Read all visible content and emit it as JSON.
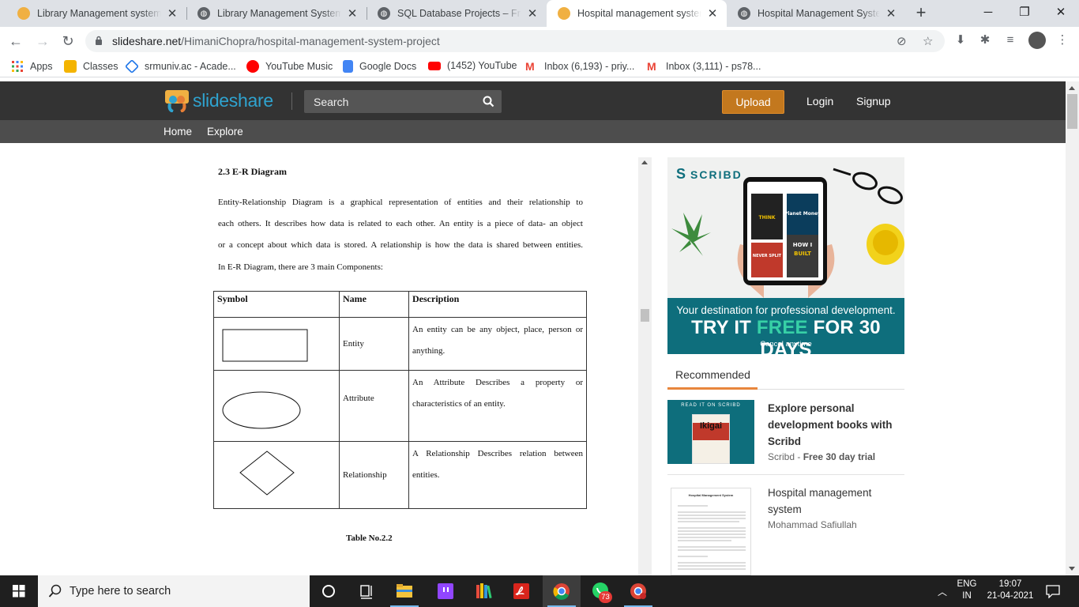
{
  "browser": {
    "tabs": [
      {
        "title": "Library Management system D",
        "favicon": "slideshare-icon",
        "active": false
      },
      {
        "title": "Library Management System D",
        "favicon": "globe-icon",
        "active": false
      },
      {
        "title": "SQL Database Projects – Free D",
        "favicon": "globe-icon",
        "active": false
      },
      {
        "title": "Hospital management system |",
        "favicon": "slideshare-icon",
        "active": true
      },
      {
        "title": "Hospital Management System",
        "favicon": "globe-icon",
        "active": false
      }
    ],
    "new_tab": "+",
    "url_host": "slideshare.net",
    "url_path": "/HimaniChopra/hospital-management-system-project",
    "bookmarks": [
      {
        "label": "Apps",
        "icon": "apps-grid-icon",
        "color": "#ea4335"
      },
      {
        "label": "Classes",
        "icon": "classroom-icon",
        "color": "#f4b400"
      },
      {
        "label": "srmuniv.ac - Acade...",
        "icon": "srm-icon",
        "color": "#1a73e8"
      },
      {
        "label": "YouTube Music",
        "icon": "youtube-music-icon",
        "color": "#ff0000"
      },
      {
        "label": "Google Docs",
        "icon": "google-docs-icon",
        "color": "#4285f4"
      },
      {
        "label": "(1452) YouTube",
        "icon": "youtube-icon",
        "color": "#ff0000"
      },
      {
        "label": "Inbox (6,193) - priy...",
        "icon": "gmail-icon",
        "color": "#ea4335"
      },
      {
        "label": "Inbox (3,111) - ps78...",
        "icon": "gmail-icon",
        "color": "#ea4335"
      }
    ]
  },
  "slideshare": {
    "logo_text": "slideshare",
    "search_placeholder": "Search",
    "upload_label": "Upload",
    "login_label": "Login",
    "signup_label": "Signup",
    "subnav": [
      "Home",
      "Explore"
    ],
    "brand_color": "#2fa3cf",
    "accent_color": "#c3781e"
  },
  "document": {
    "heading": "2.3 E-R Diagram",
    "paragraph_lines": [
      "Entity-Relationship Diagram is a graphical representation of entities and their relationship to",
      "each others. It describes how data is related to each other. An entity is a piece of data- an object",
      "or a concept about which data is stored. A relationship is how the data is shared between entities.",
      "In E-R Diagram, there are 3 main Components:"
    ],
    "table": {
      "headers": [
        "Symbol",
        "Name",
        "Description"
      ],
      "rows": [
        {
          "symbol": "rectangle",
          "name": "Entity",
          "desc_lines": [
            "An entity can be any object, place, person or",
            "anything."
          ]
        },
        {
          "symbol": "ellipse",
          "name": "Attribute",
          "desc_lines": [
            "An Attribute Describes a property or",
            "characteristics of an entity."
          ]
        },
        {
          "symbol": "diamond",
          "name": "Relationship",
          "desc_lines": [
            "A Relationship Describes relation between",
            "entities."
          ]
        }
      ]
    },
    "caption": "Table No.2.2"
  },
  "ad": {
    "brand": "SCRIBD",
    "line1": "Your destination for professional development.",
    "line2_a": "TRY IT ",
    "line2_free": "FREE",
    "line2_b": " FOR 30 DAYS",
    "line3": "Cancel anytime",
    "books": [
      "THINK LIKE A BILLIONAIRE",
      "Planet Money",
      "NEVER SPLIT THE DIFFERENCE",
      "HOW I BUILT THIS"
    ],
    "bg_color": "#0e6e7c",
    "free_color": "#37d0a6"
  },
  "recommended": {
    "title": "Recommended",
    "items": [
      {
        "title": "Explore personal development books with Scribd",
        "meta_a": "Scribd - ",
        "meta_b": "Free 30 day trial",
        "thumb_badge": "READ IT ON  SCRIBD",
        "thumb_book": "Ikigai"
      },
      {
        "title": "Hospital management system",
        "meta_a": "Mohammad Safiullah",
        "meta_b": "",
        "thumb_heading": "Hospital Management System"
      }
    ]
  },
  "taskbar": {
    "search_placeholder": "Type here to search",
    "language_line1": "ENG",
    "language_line2": "IN",
    "time": "19:07",
    "date": "21-04-2021",
    "whatsapp_badge": "73"
  }
}
